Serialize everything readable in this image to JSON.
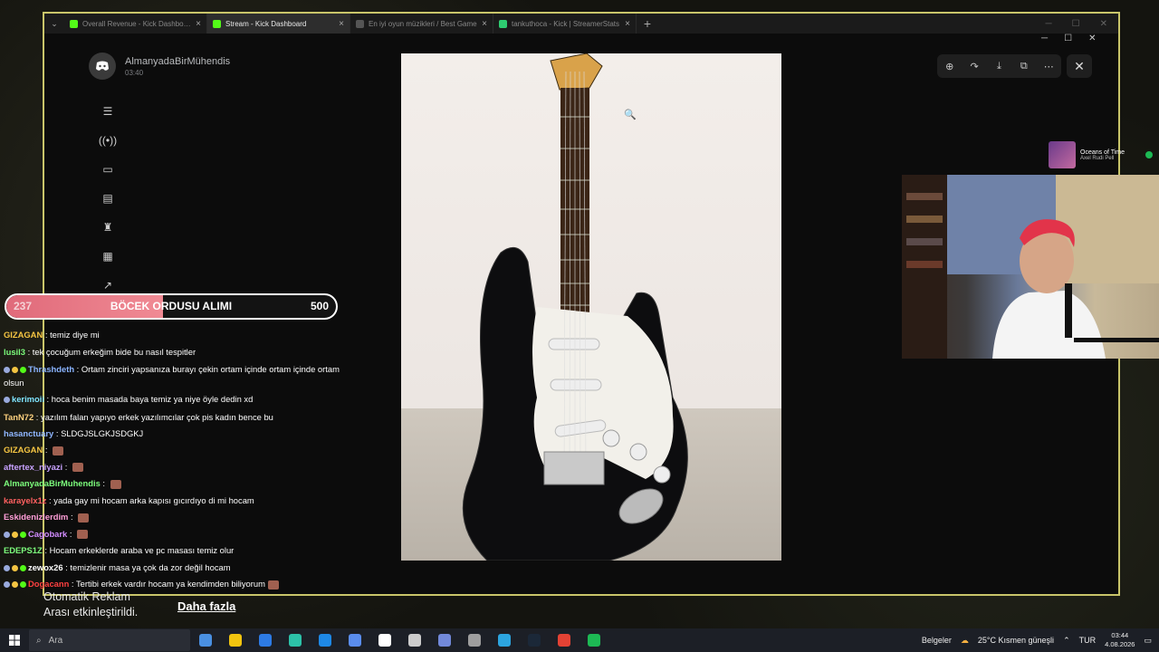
{
  "browser": {
    "tabs": [
      {
        "label": "Overall Revenue - Kick Dashboard",
        "active": false,
        "favicon_color": "#53fc18"
      },
      {
        "label": "Stream - Kick Dashboard",
        "active": true,
        "favicon_color": "#53fc18"
      },
      {
        "label": "En iyi oyun müzikleri / Best Game",
        "active": false,
        "favicon_color": "#555555"
      },
      {
        "label": "tankuthoca - Kick | StreamerStats",
        "active": false,
        "favicon_color": "#2ecc71"
      }
    ]
  },
  "viewer": {
    "username": "AlmanyadaBirMühendis",
    "time": "03:40",
    "toolbar_icons": [
      "zoom-in-icon",
      "rotate-icon",
      "download-icon",
      "open-external-icon",
      "more-icon"
    ]
  },
  "music": {
    "title": "Oceans of Time",
    "artist": "Axel Rudi Pell"
  },
  "goal": {
    "current": "237",
    "title": "BÖCEK ORDUSU ALIMI",
    "target": "500",
    "progress": 0.474,
    "color": "#e97a88"
  },
  "chat": [
    {
      "user": "GIZAGAN",
      "color": "#f5c542",
      "msg": "temiz diye mi",
      "badges": 0
    },
    {
      "user": "lusil3",
      "color": "#7cfc7c",
      "msg": "tek çocuğum erkeğim bide bu nasıl tespitler",
      "badges": 0
    },
    {
      "user": "Thrashdeth",
      "color": "#8ab4ff",
      "msg": "Ortam zinciri yapsanıza burayı çekin ortam içinde ortam içinde ortam olsun",
      "badges": 3
    },
    {
      "user": "kerimoii",
      "color": "#7fe5ff",
      "msg": "hoca benim masada baya temiz ya niye öyle dedin xd",
      "badges": 1
    },
    {
      "user": "TanN72",
      "color": "#ffd27f",
      "msg": "yazılım falan yapıyo erkek yazılımcılar çok pis kadın bence bu",
      "badges": 0
    },
    {
      "user": "hasanctuary",
      "color": "#8fb6ff",
      "msg": "SLDGJSLGKJSDGKJ",
      "badges": 0
    },
    {
      "user": "GIZAGAN",
      "color": "#f5c542",
      "msg": "",
      "badges": 0,
      "emote": true
    },
    {
      "user": "aftertex_niyazi",
      "color": "#c8a2ff",
      "msg": "",
      "badges": 0,
      "emote": true
    },
    {
      "user": "AlmanyadaBirMuhendis",
      "color": "#7cfc7c",
      "msg": "",
      "badges": 0,
      "emote": true
    },
    {
      "user": "karayelx1z",
      "color": "#ff6060",
      "msg": "yada gay mi hocam arka kapısı gıcırdıyo di mi hocam",
      "badges": 0
    },
    {
      "user": "Eskidenizlerdim",
      "color": "#ff9ed8",
      "msg": "",
      "badges": 0,
      "emote": true
    },
    {
      "user": "Cagobark",
      "color": "#d28cff",
      "msg": "",
      "badges": 3,
      "emote": true
    },
    {
      "user": "EDEPS1Z",
      "color": "#7cfc7c",
      "msg": "Hocam erkeklerde araba ve pc masası temiz olur",
      "badges": 0
    },
    {
      "user": "zewox26",
      "color": "#ffffff",
      "msg": "temizlenir masa ya çok da zor değil hocam",
      "badges": 3
    },
    {
      "user": "Dogacann",
      "color": "#ff4040",
      "msg": "Tertibi erkek vardır hocam ya kendimden biliyorum",
      "badges": 3,
      "emote": true
    }
  ],
  "ad": {
    "line1": "Otomatik Reklam",
    "line2": "Arası etkinleştirildi.",
    "more": "Daha fazla"
  },
  "taskbar": {
    "search_placeholder": "Ara",
    "documents": "Belgeler",
    "weather": "25°C  Kısmen güneşli",
    "lang": "TUR",
    "time": "03:44",
    "date": "4.08.2026",
    "apps": [
      "#4a90e2",
      "#f1c40f",
      "#2d7be5",
      "#2cc1a8",
      "#1e88e5",
      "#5a8dee",
      "#ffffff",
      "#cccccc",
      "#7289da",
      "#9e9e9e",
      "#2ca5e0",
      "#1b2838",
      "#e34234",
      "#1db954"
    ]
  }
}
